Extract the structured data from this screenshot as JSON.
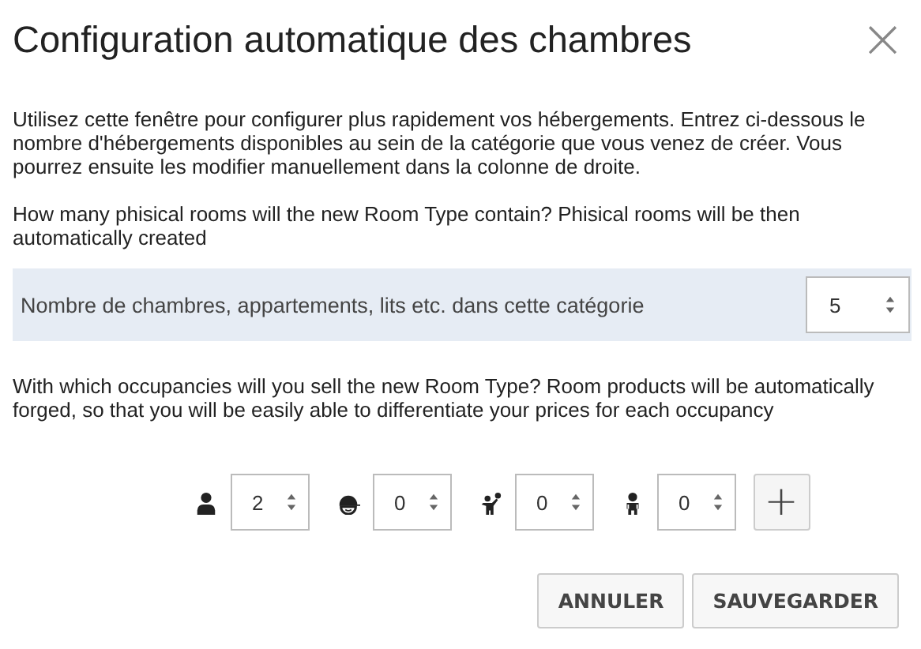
{
  "dialog": {
    "title": "Configuration automatique des chambres",
    "close": "×"
  },
  "intro": "Utilisez cette fenêtre pour configurer plus rapidement vos hébergements. Entrez ci-dessous le nombre d'hébergements disponibles au sein de la catégorie que vous venez de créer. Vous pourrez ensuite les modifier manuellement dans la colonne de droite.",
  "rooms_question": "How many phisical rooms will the new Room Type contain? Phisical rooms will be then automatically created",
  "rooms_field": {
    "label": "Nombre de chambres, appartements, lits etc. dans cette catégorie",
    "value": "5"
  },
  "occupancy_question": "With which occupancies will you sell the new Room Type? Room products will be automatically forged, so that you will be easily able to differentiate your prices for each occupancy",
  "occupancies": [
    {
      "kind": "adult",
      "value": "2"
    },
    {
      "kind": "teen",
      "value": "0"
    },
    {
      "kind": "child",
      "value": "0"
    },
    {
      "kind": "baby",
      "value": "0"
    }
  ],
  "add_button": "+",
  "buttons": [
    "ANNULER",
    "SAUVEGARDER"
  ]
}
